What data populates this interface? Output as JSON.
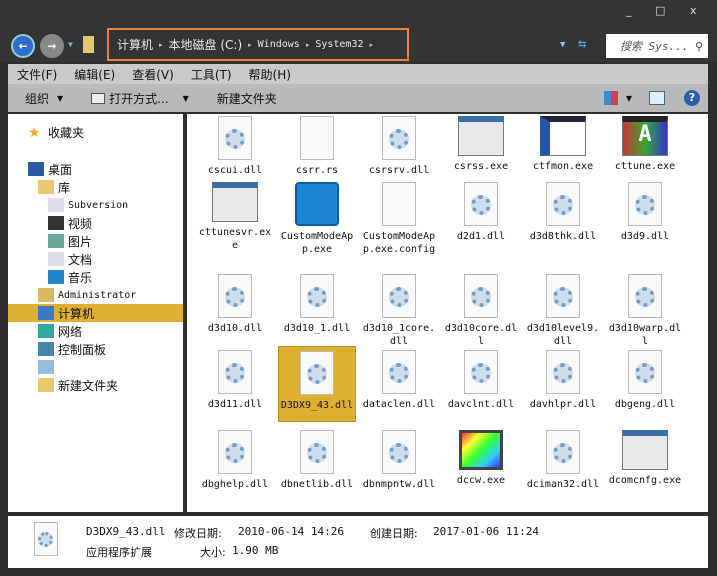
{
  "window": {
    "minimize": "_",
    "maximize": "□",
    "close": "x"
  },
  "address": {
    "segments": [
      "计算机",
      "本地磁盘 (C:)",
      "Windows",
      "System32"
    ],
    "search_placeholder": "搜索 Sys..."
  },
  "menu": [
    "文件(F)",
    "编辑(E)",
    "查看(V)",
    "工具(T)",
    "帮助(H)"
  ],
  "toolbar": {
    "organize": "组织",
    "open_with": "打开方式...",
    "new_folder": "新建文件夹"
  },
  "sidebar": [
    {
      "label": "收藏夹",
      "icon": "star-icon"
    },
    {
      "label": "桌面",
      "icon": "desktop-icon"
    },
    {
      "label": "库",
      "icon": "library-icon"
    },
    {
      "label": "Subversion",
      "icon": "document-icon"
    },
    {
      "label": "视频",
      "icon": "video-icon"
    },
    {
      "label": "图片",
      "icon": "picture-icon"
    },
    {
      "label": "文档",
      "icon": "document-icon"
    },
    {
      "label": "音乐",
      "icon": "music-icon"
    },
    {
      "label": "Administrator",
      "icon": "user-folder-icon"
    },
    {
      "label": "计算机",
      "icon": "computer-icon",
      "selected": true
    },
    {
      "label": "网络",
      "icon": "network-icon"
    },
    {
      "label": "控制面板",
      "icon": "control-panel-icon"
    },
    {
      "label": "",
      "icon": "recycle-bin-icon"
    },
    {
      "label": "新建文件夹",
      "icon": "folder-icon"
    }
  ],
  "files": [
    {
      "name": "cscui.dll",
      "type": "dll"
    },
    {
      "name": "csrr.rs",
      "type": "blank"
    },
    {
      "name": "csrsrv.dll",
      "type": "dll"
    },
    {
      "name": "csrss.exe",
      "type": "win"
    },
    {
      "name": "ctfmon.exe",
      "type": "pen"
    },
    {
      "name": "cttune.exe",
      "type": "font"
    },
    {
      "name": "cttunesvr.exe",
      "type": "win"
    },
    {
      "name": "CustomModeApp.exe",
      "type": "intel"
    },
    {
      "name": "CustomModeApp.exe.config",
      "type": "blank"
    },
    {
      "name": "d2d1.dll",
      "type": "dll"
    },
    {
      "name": "d3d8thk.dll",
      "type": "dll"
    },
    {
      "name": "d3d9.dll",
      "type": "dll"
    },
    {
      "name": "d3d10.dll",
      "type": "dll"
    },
    {
      "name": "d3d10_1.dll",
      "type": "dll"
    },
    {
      "name": "d3d10_1core.dll",
      "type": "dll"
    },
    {
      "name": "d3d10core.dll",
      "type": "dll"
    },
    {
      "name": "d3d10level9.dll",
      "type": "dll"
    },
    {
      "name": "d3d10warp.dll",
      "type": "dll"
    },
    {
      "name": "d3d11.dll",
      "type": "dll"
    },
    {
      "name": "D3DX9_43.dll",
      "type": "dll",
      "selected": true
    },
    {
      "name": "dataclen.dll",
      "type": "dll"
    },
    {
      "name": "davclnt.dll",
      "type": "dll"
    },
    {
      "name": "davhlpr.dll",
      "type": "dll"
    },
    {
      "name": "dbgeng.dll",
      "type": "dll"
    },
    {
      "name": "dbghelp.dll",
      "type": "dll"
    },
    {
      "name": "dbnetlib.dll",
      "type": "dll"
    },
    {
      "name": "dbnmpntw.dll",
      "type": "dll"
    },
    {
      "name": "dccw.exe",
      "type": "color"
    },
    {
      "name": "dciman32.dll",
      "type": "dll"
    },
    {
      "name": "dcomcnfg.exe",
      "type": "win"
    }
  ],
  "details": {
    "name": "D3DX9_43.dll",
    "modified_label": "修改日期:",
    "modified": "2010-06-14 14:26",
    "created_label": "创建日期:",
    "created": "2017-01-06 11:24",
    "type": "应用程序扩展",
    "size_label": "大小:",
    "size": "1.90 MB"
  },
  "colors": {
    "accent": "#e8813a",
    "selection": "#deb030"
  }
}
